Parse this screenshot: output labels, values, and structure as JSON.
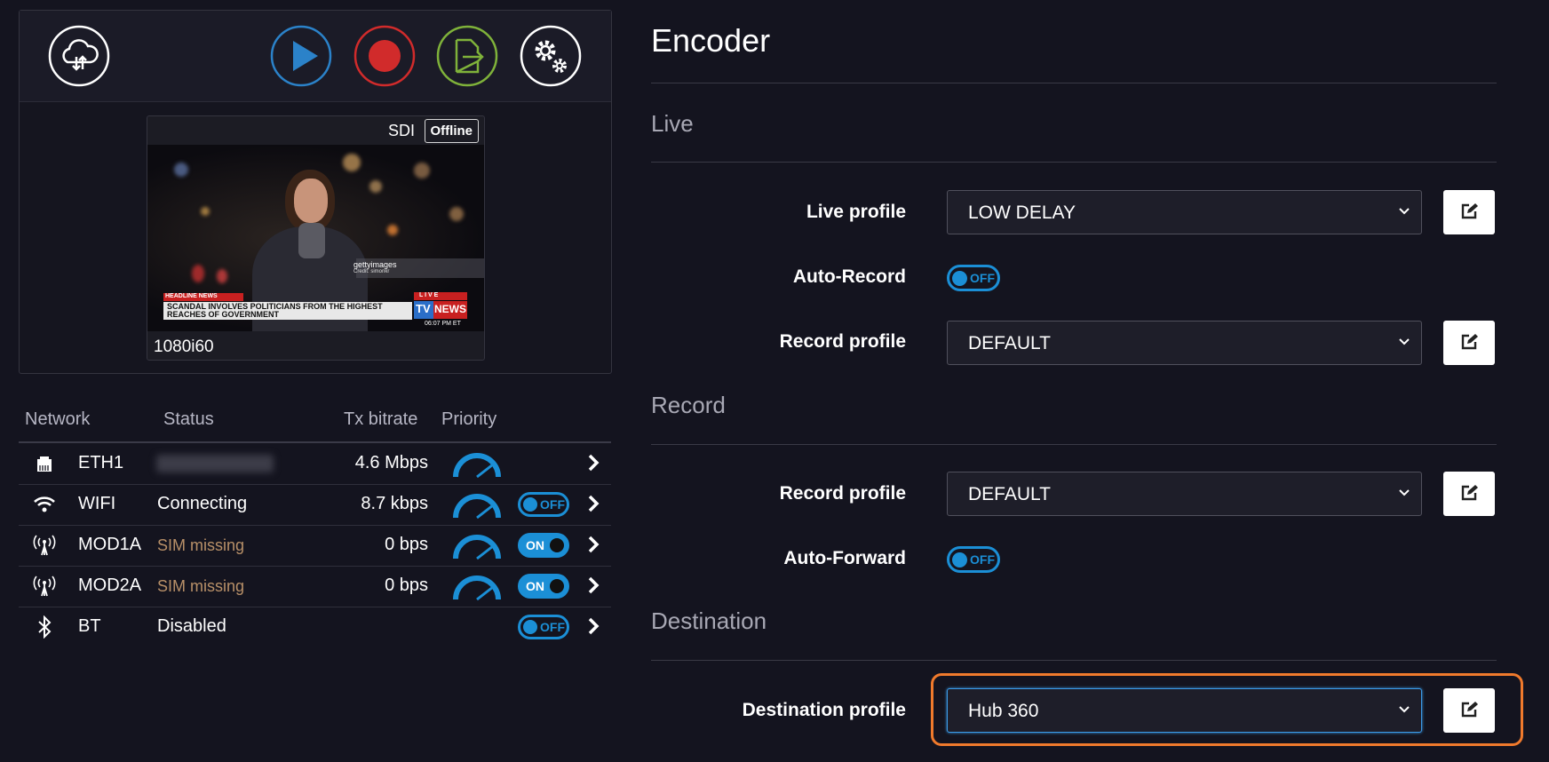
{
  "toolbar": {
    "buttons": [
      {
        "name": "cloud-sync",
        "color": "#ffffff"
      },
      {
        "name": "play",
        "color": "#2b82c9"
      },
      {
        "name": "record",
        "color": "#d12b2b"
      },
      {
        "name": "export",
        "color": "#7fb23a"
      },
      {
        "name": "settings",
        "color": "#ffffff"
      }
    ]
  },
  "preview": {
    "input": "SDI",
    "status": "Offline",
    "resolution": "1080i60",
    "overlay": {
      "brand": "gettyimages",
      "credit": "Credit: simonkr",
      "tag": "HEADLINE NEWS",
      "headline_1": "SCANDAL INVOLVES POLITICIANS FROM THE HIGHEST",
      "headline_2": "REACHES OF GOVERNMENT",
      "live": "L I V E",
      "logo_tv": "TV",
      "logo_news": "NEWS",
      "time": "06:07 PM ET"
    }
  },
  "network": {
    "headers": {
      "network": "Network",
      "status": "Status",
      "tx": "Tx bitrate",
      "priority": "Priority"
    },
    "rows": [
      {
        "name": "ETH1",
        "icon": "ethernet-icon",
        "status": "",
        "tx": "4.6 Mbps",
        "toggle": null
      },
      {
        "name": "WIFI",
        "icon": "wifi-icon",
        "status": "Connecting",
        "tx": "8.7 kbps",
        "toggle": "OFF"
      },
      {
        "name": "MOD1A",
        "icon": "antenna-icon",
        "status": "SIM missing",
        "tx": "0 bps",
        "toggle": "ON"
      },
      {
        "name": "MOD2A",
        "icon": "antenna-icon",
        "status": "SIM missing",
        "tx": "0 bps",
        "toggle": "ON"
      },
      {
        "name": "BT",
        "icon": "bluetooth-icon",
        "status": "Disabled",
        "tx": "",
        "toggle": "OFF"
      }
    ]
  },
  "encoder": {
    "title": "Encoder",
    "live": {
      "heading": "Live",
      "live_profile_label": "Live profile",
      "live_profile_value": "LOW DELAY",
      "auto_record_label": "Auto-Record",
      "auto_record_state": "OFF",
      "record_profile_label": "Record profile",
      "record_profile_value": "DEFAULT"
    },
    "record": {
      "heading": "Record",
      "record_profile_label": "Record profile",
      "record_profile_value": "DEFAULT",
      "auto_forward_label": "Auto-Forward",
      "auto_forward_state": "OFF"
    },
    "destination": {
      "heading": "Destination",
      "profile_label": "Destination profile",
      "profile_value": "Hub 360"
    }
  },
  "colors": {
    "accent": "#1b8fd6",
    "highlight": "#f07a2c",
    "warn": "#b89068"
  }
}
